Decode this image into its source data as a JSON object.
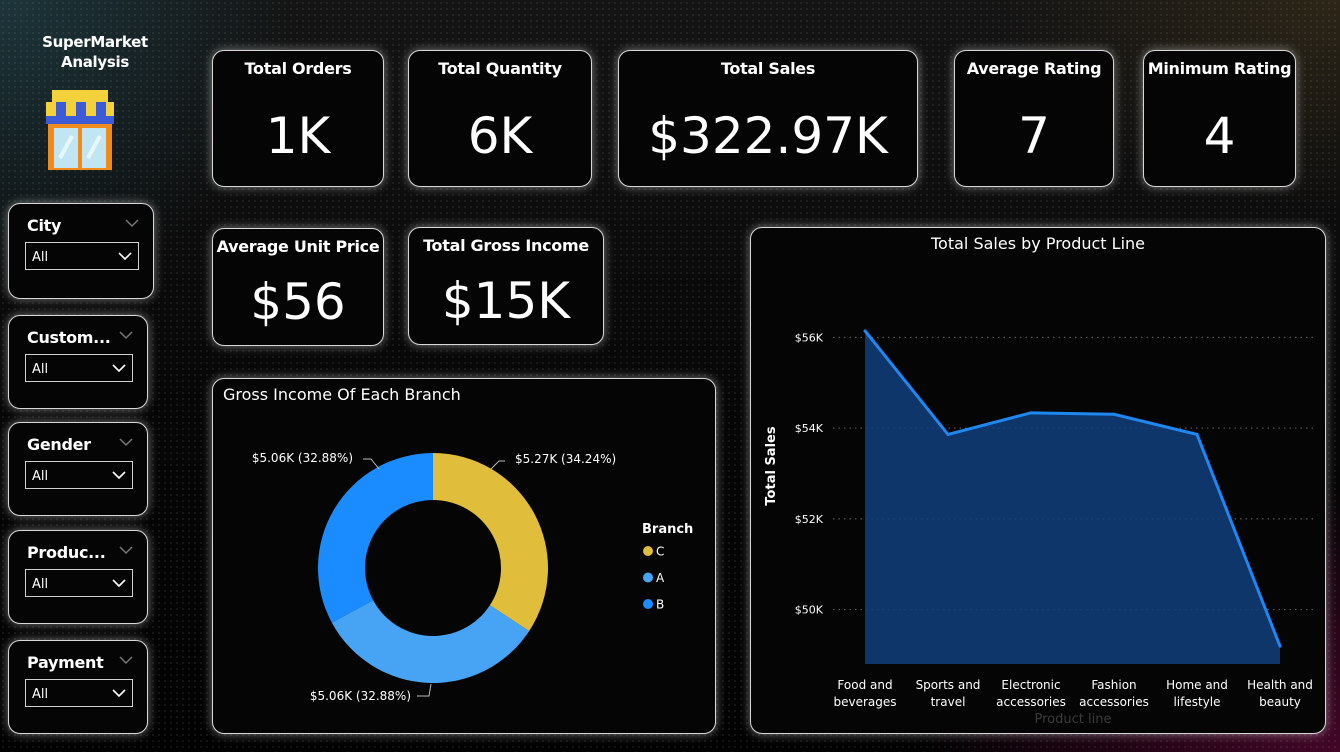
{
  "app": {
    "title": "SuperMarket Analysis",
    "title_line1": "SuperMarket",
    "title_line2": "Analysis",
    "logo_icon": "store-icon"
  },
  "slicers": [
    {
      "label": "City",
      "value": "All"
    },
    {
      "label": "Custom...",
      "value": "All"
    },
    {
      "label": "Gender",
      "value": "All"
    },
    {
      "label": "Produc...",
      "value": "All"
    },
    {
      "label": "Payment",
      "value": "All"
    }
  ],
  "kpis": {
    "total_orders": {
      "label": "Total Orders",
      "value": "1K"
    },
    "total_quantity": {
      "label": "Total Quantity",
      "value": "6K"
    },
    "total_sales": {
      "label": "Total Sales",
      "value": "$322.97K"
    },
    "average_rating": {
      "label": "Average Rating",
      "value": "7"
    },
    "minimum_rating": {
      "label": "Minimum Rating",
      "value": "4"
    },
    "average_unit_price": {
      "label": "Average Unit Price",
      "value": "$56"
    },
    "total_gross_income": {
      "label": "Total Gross Income",
      "value": "$15K"
    }
  },
  "colors": {
    "branch_c": "#e0bd3a",
    "branch_a": "#47a4f5",
    "branch_b": "#1a8cff",
    "area_fill": "#123f7e",
    "area_line": "#1e88f0"
  },
  "chart_data": [
    {
      "type": "pie",
      "title": "Gross Income Of Each Branch",
      "legend_title": "Branch",
      "legend_position": "right",
      "donut": true,
      "categories": [
        "C",
        "A",
        "B"
      ],
      "values": [
        5.27,
        5.06,
        5.06
      ],
      "unit": "$K",
      "labels": [
        "$5.27K (34.24%)",
        "$5.06K (32.88%)",
        "$5.06K (32.88%)"
      ]
    },
    {
      "type": "area",
      "title": "Total Sales by Product Line",
      "xlabel": "Product line",
      "ylabel": "Total Sales",
      "categories": [
        "Food and beverages",
        "Sports and travel",
        "Electronic accessories",
        "Fashion accessories",
        "Home and lifestyle",
        "Health and beauty"
      ],
      "category_lines": [
        [
          "Food and",
          "beverages"
        ],
        [
          "Sports and",
          "travel"
        ],
        [
          "Electronic",
          "accessories"
        ],
        [
          "Fashion",
          "accessories"
        ],
        [
          "Home and",
          "lifestyle"
        ],
        [
          "Health and",
          "beauty"
        ]
      ],
      "values": [
        56144.8,
        53861.9,
        54337.5,
        54305.9,
        53861.9,
        49193.7
      ],
      "yticks": [
        50000,
        52000,
        54000,
        56000
      ],
      "ytick_labels": [
        "$50K",
        "$52K",
        "$54K",
        "$56K"
      ],
      "ylim": [
        48800,
        57200
      ],
      "grid": true
    }
  ]
}
